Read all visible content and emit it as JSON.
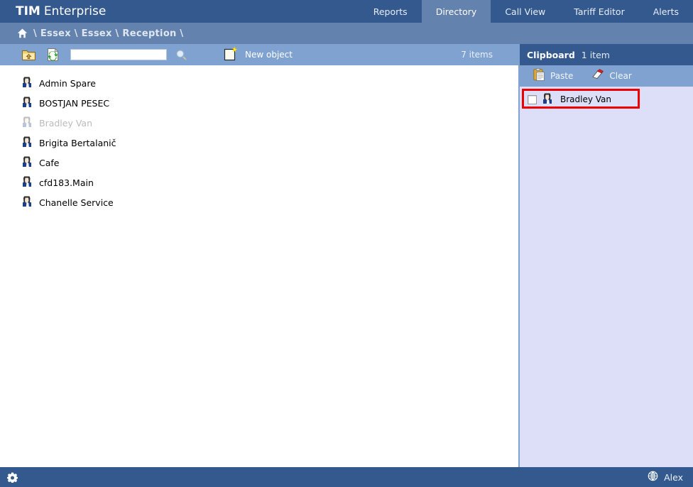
{
  "header": {
    "brand_bold": "TIM",
    "brand_light": "Enterprise",
    "tabs": [
      {
        "label": "Reports",
        "active": false
      },
      {
        "label": "Directory",
        "active": true
      },
      {
        "label": "Call View",
        "active": false
      },
      {
        "label": "Tariff Editor",
        "active": false
      },
      {
        "label": "Alerts",
        "active": false
      }
    ],
    "bg_color": "#33598f",
    "active_tab_color": "#6382ad"
  },
  "breadcrumb": {
    "home_icon": "home-icon",
    "path": "\\ Essex \\ Essex \\ Reception \\"
  },
  "toolbar": {
    "up_icon": "folder-up-icon",
    "refresh_icon": "refresh-icon",
    "search_value": "",
    "search_placeholder": "",
    "search_go_icon": "magnifier-icon",
    "new_object_icon": "new-document-icon",
    "new_object_label": "New object",
    "item_count": "7 items"
  },
  "directory": {
    "items": [
      {
        "label": "Admin Spare",
        "icon": "user-icon",
        "dimmed": false
      },
      {
        "label": "BOSTJAN PESEC",
        "icon": "user-icon",
        "dimmed": false
      },
      {
        "label": "Bradley Van",
        "icon": "user-icon",
        "dimmed": true
      },
      {
        "label": "Brigita Bertalanič",
        "icon": "user-icon",
        "dimmed": false
      },
      {
        "label": "Cafe",
        "icon": "user-icon",
        "dimmed": false
      },
      {
        "label": "cfd183.Main",
        "icon": "user-icon",
        "dimmed": false
      },
      {
        "label": "Chanelle Service",
        "icon": "user-icon",
        "dimmed": false
      }
    ]
  },
  "clipboard": {
    "title": "Clipboard",
    "count": "1 item",
    "paste_icon": "paste-icon",
    "paste_label": "Paste",
    "clear_icon": "eraser-icon",
    "clear_label": "Clear",
    "items": [
      {
        "label": "Bradley Van",
        "icon": "user-icon",
        "checked": false,
        "highlighted": true
      }
    ],
    "highlight_color": "#ee0000",
    "panel_color": "#dcdff7"
  },
  "footer": {
    "settings_icon": "gear-icon",
    "user_icon": "globe-icon",
    "user_label": "Alex"
  }
}
